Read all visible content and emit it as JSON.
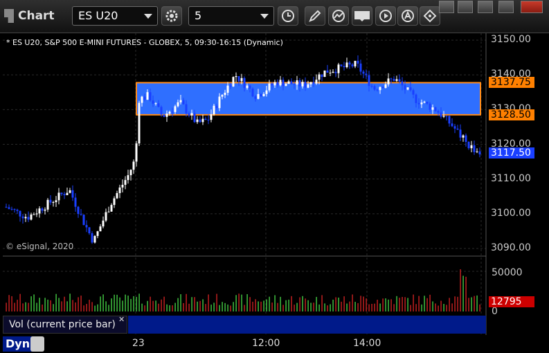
{
  "toolbar": {
    "app_title": "Chart",
    "symbol": "ES U20",
    "interval": "5",
    "buttons": [
      "settings-gear-icon",
      "clock-icon",
      "pencil-draw-icon",
      "study-curve-icon",
      "get-data-icon",
      "play-icon",
      "a-text-icon",
      "alert-tag-icon"
    ],
    "window_buttons": [
      "pin",
      "minimize",
      "maximize",
      "close"
    ]
  },
  "chart": {
    "info_line": "* ES U20, S&P 500 E-MINI FUTURES - GLOBEX, 5, 09:30-16:15 (Dynamic)",
    "copyright": "© eSignal, 2020",
    "price_axis": [
      "3150.00",
      "3140.00",
      "3130.00",
      "3120.00",
      "3110.00",
      "3100.00",
      "3090.00"
    ],
    "price_badges": [
      {
        "text": "3137.75",
        "color": "#ff8000",
        "text_color": "#000000"
      },
      {
        "text": "3128.50",
        "color": "#ff8000",
        "text_color": "#000000"
      },
      {
        "text": "3117.50",
        "color": "#1a3fff",
        "text_color": "#ffffff"
      }
    ],
    "zone": {
      "top": 3137.75,
      "bottom": 3128.5,
      "fill": "#2f6fff",
      "border": "#ff8c1a"
    },
    "ylim": [
      3088,
      3152
    ]
  },
  "volume": {
    "label": "Vol (current price bar)",
    "axis": [
      "50000",
      "0"
    ],
    "current_badge": {
      "text": "12795",
      "color": "#cc0000"
    }
  },
  "time_axis": {
    "labels": [
      "23",
      "12:00",
      "14:00"
    ],
    "mode_label": "Dyn"
  },
  "colors": {
    "up": "#ffffff",
    "down": "#1a3fff",
    "vol_up": "#3cb43c",
    "vol_down": "#b41e1e"
  }
}
